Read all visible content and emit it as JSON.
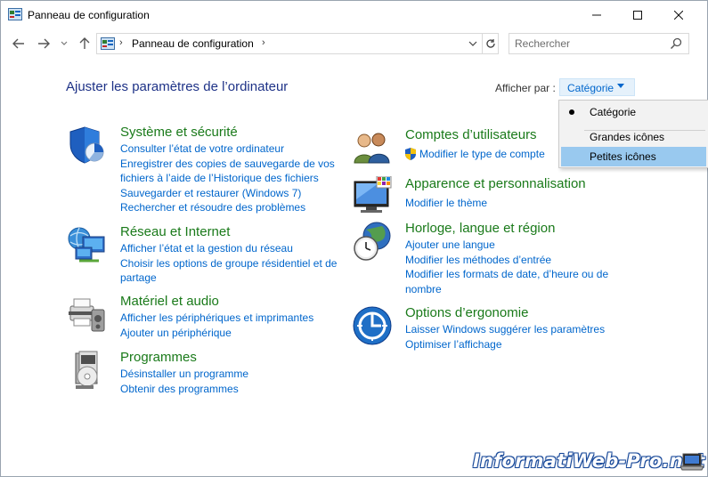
{
  "window": {
    "title": "Panneau de configuration"
  },
  "address": {
    "crumb": "Panneau de configuration",
    "search_placeholder": "Rechercher"
  },
  "main": {
    "title": "Ajuster les paramètres de l’ordinateur",
    "view_by_label": "Afficher par :",
    "view_by_value": "Catégorie"
  },
  "view_menu": {
    "items": [
      {
        "label": "Catégorie",
        "checked": true
      },
      {
        "label": "Grandes icônes"
      },
      {
        "label": "Petites icônes",
        "highlighted": true
      }
    ]
  },
  "categories_left": [
    {
      "title": "Système et sécurité",
      "icon": "shield-icon",
      "links": [
        "Consulter l’état de votre ordinateur",
        "Enregistrer des copies de sauvegarde de vos",
        "fichiers à l’aide de l’Historique des fichiers",
        "Sauvegarder et restaurer (Windows 7)",
        "Rechercher et résoudre des problèmes"
      ]
    },
    {
      "title": "Réseau et Internet",
      "icon": "network-icon",
      "links": [
        "Afficher l’état et la gestion du réseau",
        "Choisir les options de groupe résidentiel et de",
        "partage"
      ]
    },
    {
      "title": "Matériel et audio",
      "icon": "printer-icon",
      "links": [
        "Afficher les périphériques et imprimantes",
        "Ajouter un périphérique"
      ]
    },
    {
      "title": "Programmes",
      "icon": "programs-icon",
      "links": [
        "Désinstaller un programme",
        "Obtenir des programmes"
      ]
    }
  ],
  "categories_right": [
    {
      "title": "Comptes d’utilisateurs",
      "icon": "users-icon",
      "links": [
        "Modifier le type de compte"
      ]
    },
    {
      "title": "Apparence et personnalisation",
      "icon": "monitor-icon",
      "links": [
        "Modifier le thème"
      ]
    },
    {
      "title": "Horloge, langue et région",
      "icon": "clock-globe-icon",
      "links": [
        "Ajouter une langue",
        "Modifier les méthodes d’entrée",
        "Modifier les formats de date, d’heure ou de",
        "nombre"
      ]
    },
    {
      "title": "Options d’ergonomie",
      "icon": "ease-of-access-icon",
      "links": [
        "Laisser Windows suggérer les paramètres",
        "Optimiser l’affichage"
      ]
    }
  ],
  "watermark": "InformatiWeb-Pro.net",
  "colors": {
    "link": "#0066cc",
    "category_title": "#1a7a1a",
    "page_title": "#1e3287",
    "menu_highlight": "#99c9ef"
  }
}
